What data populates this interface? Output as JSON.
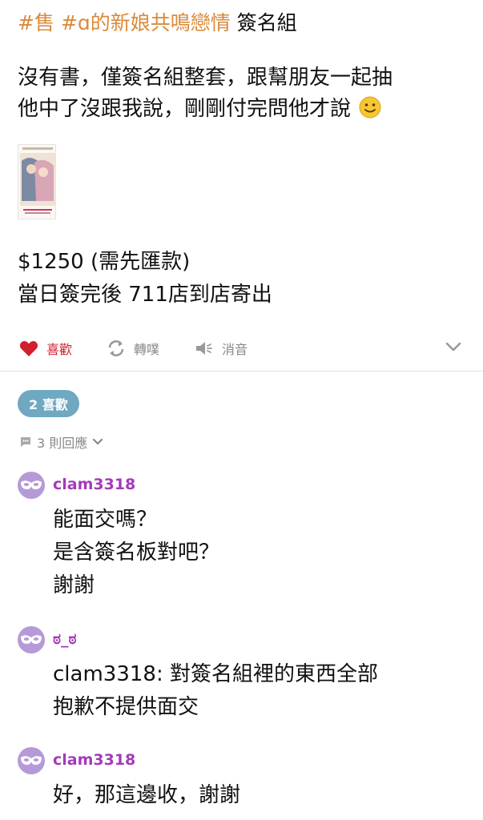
{
  "post": {
    "tags": [
      "#售",
      "#ɑ的新娘共鳴戀情"
    ],
    "title": "簽名組",
    "body_lines": [
      "沒有書，僅簽名組整套，跟幫朋友一起抽",
      "他中了沒跟我說，剛剛付完問他才說"
    ],
    "price_lines": [
      "$1250 (需先匯款)",
      "當日簽完後 711店到店寄出"
    ]
  },
  "actions": {
    "like": {
      "label": "喜歡",
      "icon": "heart-icon"
    },
    "repost": {
      "label": "轉噗",
      "icon": "repost-icon"
    },
    "mute": {
      "label": "消音",
      "icon": "speaker-icon"
    },
    "expand_icon": "chevron-down-icon"
  },
  "likes_pill": "2 喜歡",
  "replies_toggle": "3 則回應",
  "comments": [
    {
      "user": "clam3318",
      "lines": [
        "能面交嗎？",
        "是含簽名板對吧？",
        "謝謝"
      ]
    },
    {
      "user": "ಠ_ಠ",
      "lines": [
        "clam3318: 對簽名組裡的東西全部",
        "抱歉不提供面交"
      ]
    },
    {
      "user": "clam3318",
      "lines": [
        "好，那這邊收，謝謝"
      ]
    }
  ],
  "colors": {
    "tag": "#d98a3a",
    "like": "#d11f2d",
    "username": "#a43ab8",
    "pill": "#6fa8c0",
    "avatar": "#b59ad8"
  }
}
